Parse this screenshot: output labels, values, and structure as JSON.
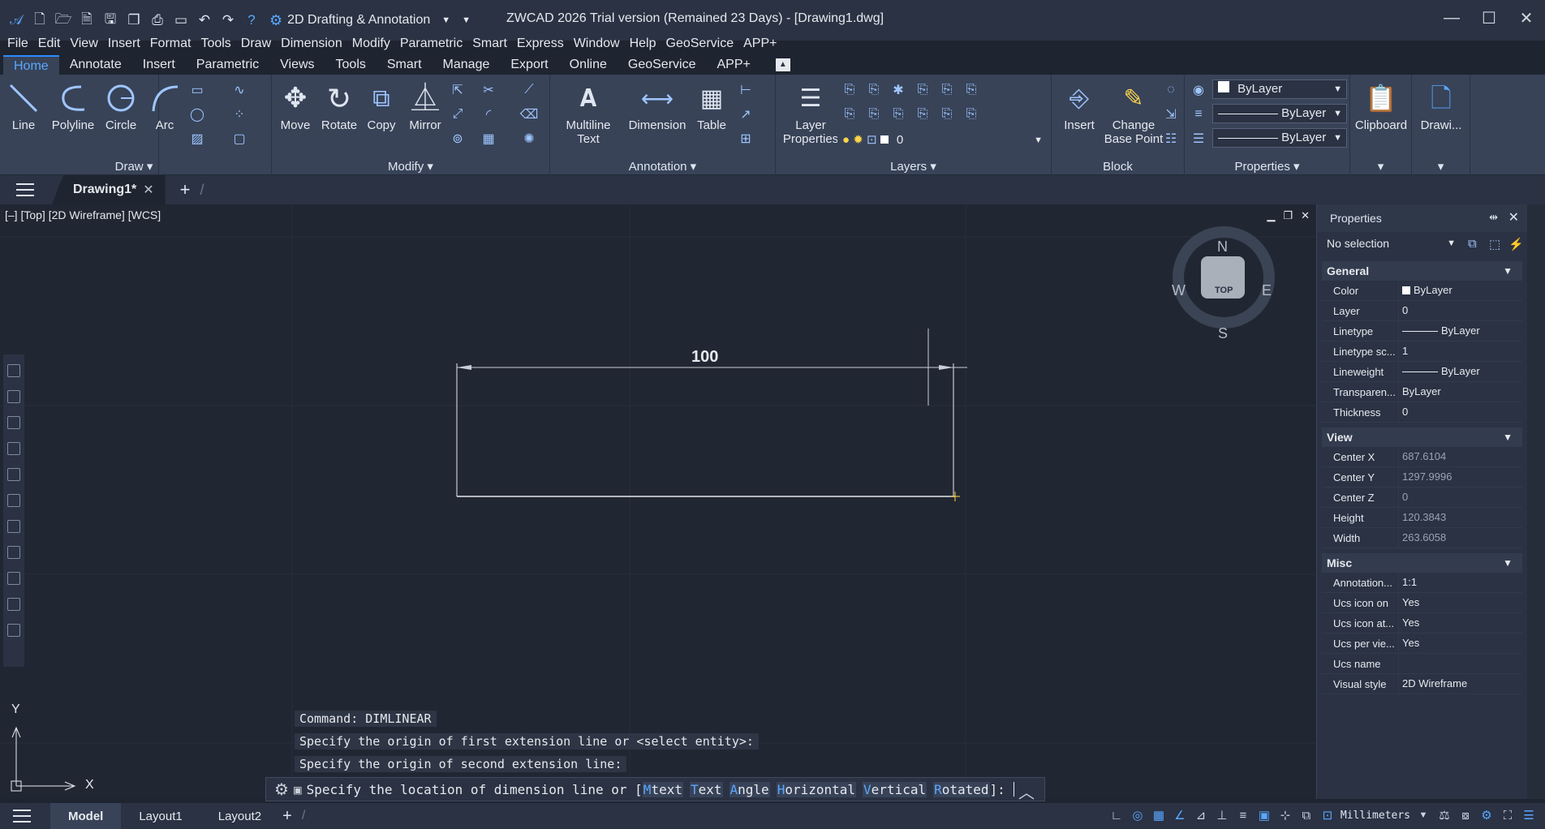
{
  "titlebar": {
    "workspace": "2D Drafting & Annotation",
    "title": "ZWCAD 2026 Trial version (Remained 23 Days) - [Drawing1.dwg]"
  },
  "menu": [
    "File",
    "Edit",
    "View",
    "Insert",
    "Format",
    "Tools",
    "Draw",
    "Dimension",
    "Modify",
    "Parametric",
    "Smart",
    "Express",
    "Window",
    "Help",
    "GeoService",
    "APP+"
  ],
  "ribbon_tabs": [
    "Home",
    "Annotate",
    "Insert",
    "Parametric",
    "Views",
    "Tools",
    "Smart",
    "Manage",
    "Export",
    "Online",
    "GeoService",
    "APP+"
  ],
  "ribbon": {
    "draw": {
      "title": "Draw",
      "tools": [
        "Line",
        "Polyline",
        "Circle",
        "Arc"
      ]
    },
    "modify": {
      "title": "Modify",
      "tools": [
        "Move",
        "Rotate",
        "Copy",
        "Mirror"
      ]
    },
    "annotation": {
      "title": "Annotation",
      "multiline": "Multiline",
      "multiline2": "Text",
      "dimension": "Dimension",
      "table": "Table"
    },
    "layers": {
      "title": "Layers",
      "layer_props1": "Layer",
      "layer_props2": "Properties",
      "current_layer": "0"
    },
    "block": {
      "title": "Block",
      "insert": "Insert",
      "change1": "Change",
      "change2": "Base Point"
    },
    "properties": {
      "title": "Properties",
      "color": "ByLayer",
      "linetype": "ByLayer",
      "lineweight": "ByLayer"
    },
    "clipboard": "Clipboard",
    "drawing": "Drawi..."
  },
  "doc_tab": "Drawing1*",
  "viewport": {
    "label": "[–] [Top] [2D Wireframe] [WCS]",
    "dimension_text": "100",
    "compass": {
      "n": "N",
      "s": "S",
      "e": "E",
      "w": "W",
      "top": "TOP"
    },
    "ucs_x": "X",
    "ucs_y": "Y"
  },
  "command_history": [
    "Command: DIMLINEAR",
    "Specify the origin of first extension line or <select entity>:",
    "Specify the origin of second extension line:"
  ],
  "command_prompt": {
    "prefix": "Specify the location of dimension line or [",
    "options": [
      {
        "key": "M",
        "rest": "text"
      },
      {
        "key": "T",
        "rest": "ext"
      },
      {
        "key": "A",
        "rest": "ngle"
      },
      {
        "key": "H",
        "rest": "orizontal"
      },
      {
        "key": "V",
        "rest": "ertical"
      },
      {
        "key": "R",
        "rest": "otated"
      }
    ],
    "suffix": "]:"
  },
  "properties_panel": {
    "title": "Properties",
    "selection": "No selection",
    "general": {
      "title": "General",
      "rows": [
        {
          "k": "Color",
          "v": "ByLayer"
        },
        {
          "k": "Layer",
          "v": "0"
        },
        {
          "k": "Linetype",
          "v": "ByLayer"
        },
        {
          "k": "Linetype sc...",
          "v": "1"
        },
        {
          "k": "Lineweight",
          "v": "ByLayer"
        },
        {
          "k": "Transparen...",
          "v": "ByLayer"
        },
        {
          "k": "Thickness",
          "v": "0"
        }
      ]
    },
    "view": {
      "title": "View",
      "rows": [
        {
          "k": "Center X",
          "v": "687.6104"
        },
        {
          "k": "Center Y",
          "v": "1297.9996"
        },
        {
          "k": "Center Z",
          "v": "0"
        },
        {
          "k": "Height",
          "v": "120.3843"
        },
        {
          "k": "Width",
          "v": "263.6058"
        }
      ]
    },
    "misc": {
      "title": "Misc",
      "rows": [
        {
          "k": "Annotation...",
          "v": "1:1"
        },
        {
          "k": "Ucs icon on",
          "v": "Yes"
        },
        {
          "k": "Ucs icon at...",
          "v": "Yes"
        },
        {
          "k": "Ucs per vie...",
          "v": "Yes"
        },
        {
          "k": "Ucs name",
          "v": ""
        },
        {
          "k": "Visual style",
          "v": "2D Wireframe"
        }
      ]
    }
  },
  "status": {
    "tabs": [
      "Model",
      "Layout1",
      "Layout2"
    ],
    "units": "Millimeters"
  }
}
